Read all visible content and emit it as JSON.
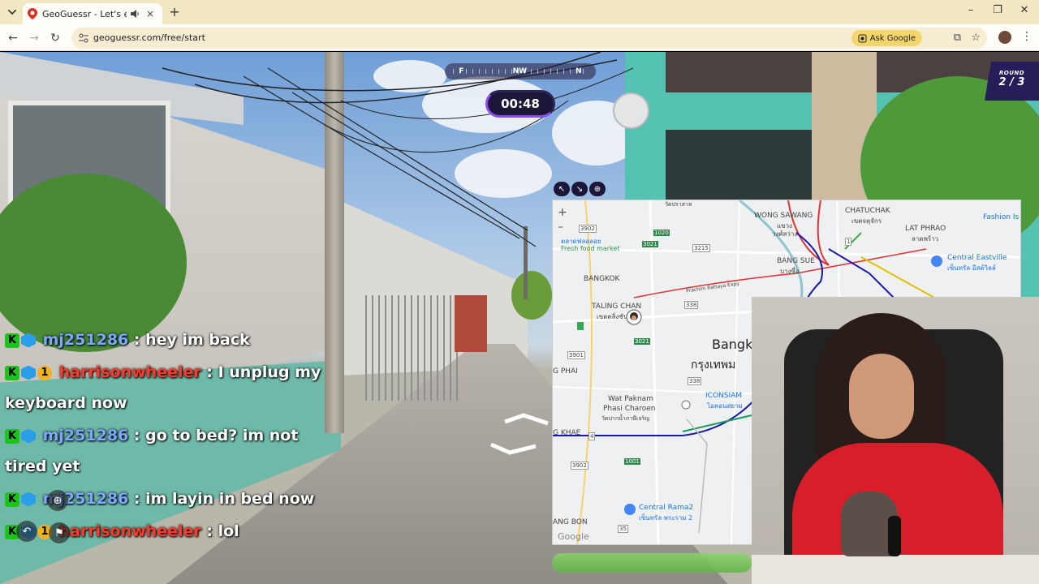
{
  "browser": {
    "tab_title": "GeoGuessr - Let's explore the",
    "url": "geoguessr.com/free/start",
    "ask_google": "Ask Google",
    "new_tab": "+",
    "tab_close": "×",
    "min": "–",
    "restore": "❐",
    "close": "✕"
  },
  "game": {
    "compass": {
      "left": "F",
      "center": "NW",
      "right": "N"
    },
    "timer": "00:48",
    "round_label": "ROUND",
    "round_value": "2 / 3"
  },
  "map": {
    "zoom_in": "+",
    "zoom_out": "–",
    "labels": [
      {
        "text": "WONG SAWANG"
      },
      {
        "text": "แขวง"
      },
      {
        "text": "วงศ์สว่าง"
      },
      {
        "text": "CHATUCHAK"
      },
      {
        "text": "เขตจตุจักร"
      },
      {
        "text": "LAT PHRAO"
      },
      {
        "text": "ลาดพร้าว"
      },
      {
        "text": "Fashion Is"
      },
      {
        "text": "Central Eastville"
      },
      {
        "text": "เซ็นทรัล อีสต์วิลล์"
      },
      {
        "text": "ตลาดฟลอลอย"
      },
      {
        "text": "Fresh food market"
      },
      {
        "text": "BANGKOK"
      },
      {
        "text": "BANG SUE"
      },
      {
        "text": "บางซื่อ"
      },
      {
        "text": "TALING CHAN"
      },
      {
        "text": "เขตตลิ่งชัน"
      },
      {
        "text": "Bangk"
      },
      {
        "text": "กรุงเทพม"
      },
      {
        "text": "G PHAI"
      },
      {
        "text": "ICONSIAM"
      },
      {
        "text": "ไอคอนสยาม"
      },
      {
        "text": "Wat Paknam"
      },
      {
        "text": "Phasi Charoen"
      },
      {
        "text": "วัดปากน้ำภาษีเจริญ"
      },
      {
        "text": "G KHAE"
      },
      {
        "text": "Central Rama2"
      },
      {
        "text": "เซ็นทรัล พระราม 2"
      },
      {
        "text": "ANG BON"
      },
      {
        "text": "Google"
      },
      {
        "text": "วัดปราสาท"
      },
      {
        "text": "Prachim Rattaya Expy"
      }
    ],
    "road_numbers": [
      "3902",
      "3021",
      "1020",
      "3215",
      "338",
      "3901",
      "3021",
      "1",
      "338",
      "3902",
      "1001",
      "4",
      "35"
    ]
  },
  "chat": [
    {
      "user": "mj251286",
      "user_color": "blue",
      "badges": [
        "K",
        "cube"
      ],
      "text": " : hey im back"
    },
    {
      "user": "harrisonwheeler",
      "user_color": "red",
      "badges": [
        "K",
        "cube",
        "1"
      ],
      "text": " : I unplug my keyboard now"
    },
    {
      "user": "mj251286",
      "user_color": "blue",
      "badges": [
        "K",
        "cube"
      ],
      "text": " : go to bed? im not tired yet"
    },
    {
      "user": "mj251286",
      "user_color": "blue",
      "badges": [
        "K",
        "cube"
      ],
      "text": " : im layin in bed now"
    },
    {
      "user": "harrisonwheeler",
      "user_color": "red",
      "badges": [
        "K",
        "cube",
        "1"
      ],
      "text": " : lol"
    }
  ],
  "colors": {
    "accent": "#8a4cf0",
    "panel": "#1c1638",
    "round_panel": "#251e59",
    "tabstrip": "#f3e8c4",
    "ask_google_bg": "#f3d66b"
  }
}
